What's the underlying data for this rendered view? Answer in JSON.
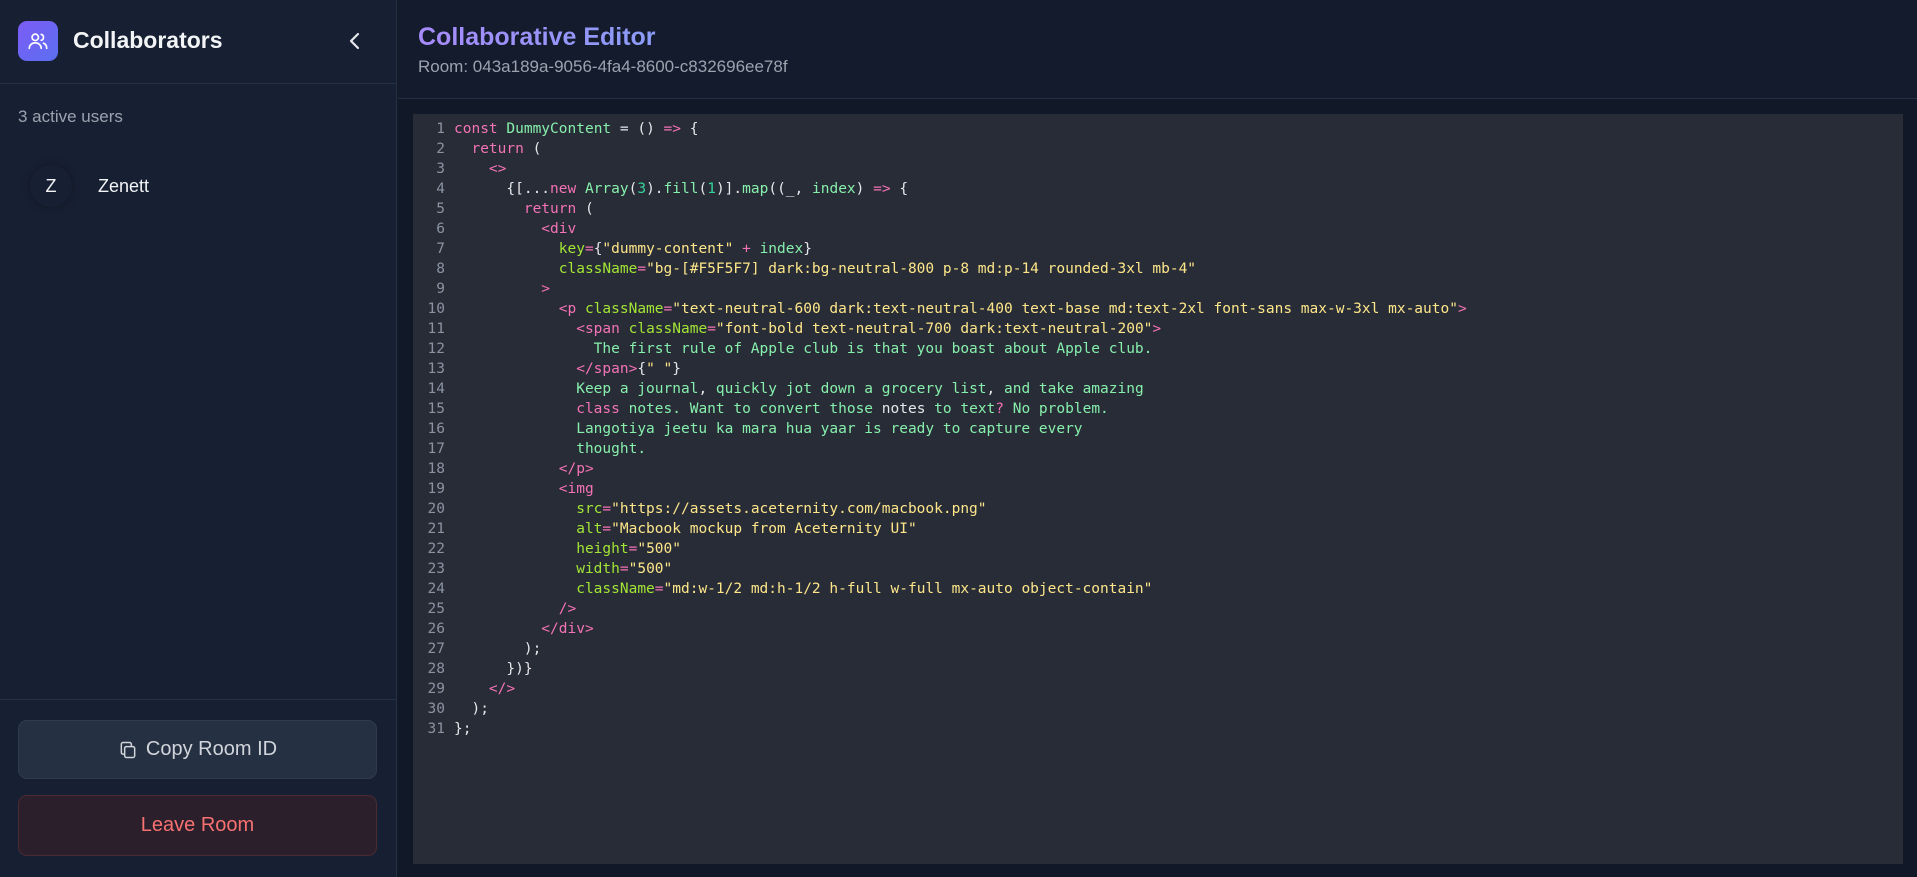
{
  "sidebar": {
    "title": "Collaborators",
    "active_users": "3 active users",
    "users": [
      {
        "initial": "Z",
        "name": "Zenett"
      }
    ],
    "copy_label": "Copy Room ID",
    "leave_label": "Leave Room",
    "icons": {
      "logo": "users-icon",
      "collapse": "chevron-left-icon",
      "copy": "copy-icon"
    }
  },
  "header": {
    "title": "Collaborative Editor",
    "room": "Room: 043a189a-9056-4fa4-8600-c832696ee78f"
  },
  "colors": {
    "accent": "#7c5cf6",
    "danger": "#f87171",
    "keyword": "#f472b6",
    "string": "#fde68a",
    "identifier": "#86efac"
  },
  "editor": {
    "lines": [
      [
        [
          "k",
          "const "
        ],
        [
          "f",
          "DummyContent"
        ],
        [
          "p",
          " = () "
        ],
        [
          "k",
          "=>"
        ],
        [
          "p",
          " {"
        ]
      ],
      [
        [
          "k",
          "  return"
        ],
        [
          "p",
          " ("
        ]
      ],
      [
        [
          "k",
          "    <>"
        ]
      ],
      [
        [
          "p",
          "      {[..."
        ],
        [
          "k",
          "new "
        ],
        [
          "f",
          "Array"
        ],
        [
          "p",
          "("
        ],
        [
          "n",
          "3"
        ],
        [
          "p",
          ")."
        ],
        [
          "f",
          "fill"
        ],
        [
          "p",
          "("
        ],
        [
          "n",
          "1"
        ],
        [
          "p",
          ")]."
        ],
        [
          "f",
          "map"
        ],
        [
          "p",
          "((_, "
        ],
        [
          "f",
          "index"
        ],
        [
          "p",
          ") "
        ],
        [
          "k",
          "=>"
        ],
        [
          "p",
          " {"
        ]
      ],
      [
        [
          "k",
          "        return"
        ],
        [
          "p",
          " ("
        ]
      ],
      [
        [
          "k",
          "          <div"
        ]
      ],
      [
        [
          "a",
          "            key"
        ],
        [
          "k",
          "="
        ],
        [
          "p",
          "{"
        ],
        [
          "s",
          "\"dummy-content\""
        ],
        [
          "k",
          " + "
        ],
        [
          "f",
          "index"
        ],
        [
          "p",
          "}"
        ]
      ],
      [
        [
          "a",
          "            className"
        ],
        [
          "k",
          "="
        ],
        [
          "s",
          "\"bg-[#F5F5F7] dark:bg-neutral-800 p-8 md:p-14 rounded-3xl mb-4\""
        ]
      ],
      [
        [
          "k",
          "          >"
        ]
      ],
      [
        [
          "k",
          "            <p "
        ],
        [
          "a",
          "className"
        ],
        [
          "k",
          "="
        ],
        [
          "s",
          "\"text-neutral-600 dark:text-neutral-400 text-base md:text-2xl font-sans max-w-3xl mx-auto\""
        ],
        [
          "k",
          ">"
        ]
      ],
      [
        [
          "k",
          "              <span "
        ],
        [
          "a",
          "className"
        ],
        [
          "k",
          "="
        ],
        [
          "s",
          "\"font-bold text-neutral-700 dark:text-neutral-200\""
        ],
        [
          "k",
          ">"
        ]
      ],
      [
        [
          "t",
          "                The first rule of Apple club is that you boast about Apple club."
        ]
      ],
      [
        [
          "k",
          "              </span>"
        ],
        [
          "p",
          "{"
        ],
        [
          "s",
          "\" \""
        ],
        [
          "p",
          "}"
        ]
      ],
      [
        [
          "t",
          "              Keep a journal"
        ],
        [
          "p",
          ","
        ],
        [
          "t",
          " quickly jot down a grocery list"
        ],
        [
          "p",
          ","
        ],
        [
          "t",
          " and take amazing"
        ]
      ],
      [
        [
          "k",
          "              class"
        ],
        [
          "t",
          " notes. Want to convert those "
        ],
        [
          "p",
          "notes"
        ],
        [
          "t",
          " to text"
        ],
        [
          "k",
          "?"
        ],
        [
          "t",
          " No problem."
        ]
      ],
      [
        [
          "t",
          "              Langotiya jeetu ka mara hua yaar is ready to capture every"
        ]
      ],
      [
        [
          "t",
          "              thought."
        ]
      ],
      [
        [
          "k",
          "            </p>"
        ]
      ],
      [
        [
          "k",
          "            <img"
        ]
      ],
      [
        [
          "a",
          "              src"
        ],
        [
          "k",
          "="
        ],
        [
          "s",
          "\"https://assets.aceternity.com/macbook.png\""
        ]
      ],
      [
        [
          "a",
          "              alt"
        ],
        [
          "k",
          "="
        ],
        [
          "s",
          "\"Macbook mockup from Aceternity UI\""
        ]
      ],
      [
        [
          "a",
          "              height"
        ],
        [
          "k",
          "="
        ],
        [
          "s",
          "\"500\""
        ]
      ],
      [
        [
          "a",
          "              width"
        ],
        [
          "k",
          "="
        ],
        [
          "s",
          "\"500\""
        ]
      ],
      [
        [
          "a",
          "              className"
        ],
        [
          "k",
          "="
        ],
        [
          "s",
          "\"md:w-1/2 md:h-1/2 h-full w-full mx-auto object-contain\""
        ]
      ],
      [
        [
          "k",
          "            />"
        ]
      ],
      [
        [
          "k",
          "          </div>"
        ]
      ],
      [
        [
          "p",
          "        );"
        ]
      ],
      [
        [
          "p",
          "      })}"
        ]
      ],
      [
        [
          "k",
          "    </>"
        ]
      ],
      [
        [
          "p",
          "  );"
        ]
      ],
      [
        [
          "p",
          "};"
        ]
      ]
    ]
  }
}
